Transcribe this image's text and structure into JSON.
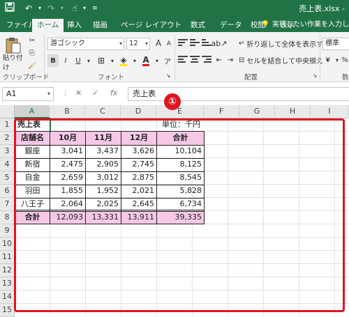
{
  "window": {
    "filename": "売上表.xlsx -"
  },
  "quick_access": {
    "save_icon": "save-icon",
    "undo_icon": "undo-icon",
    "redo_icon": "redo-icon",
    "touch_icon": "touch-mode-icon",
    "customize_icon": "customize-icon"
  },
  "tabs": [
    {
      "label": "ファイル",
      "active": false
    },
    {
      "label": "ホーム",
      "active": true
    },
    {
      "label": "挿入",
      "active": false
    },
    {
      "label": "描画",
      "active": false
    },
    {
      "label": "ページ レイアウト",
      "active": false
    },
    {
      "label": "数式",
      "active": false
    },
    {
      "label": "データ",
      "active": false
    },
    {
      "label": "校閲",
      "active": false
    },
    {
      "label": "表示",
      "active": false
    }
  ],
  "tell_me": "実行したい作業を入力し",
  "ribbon": {
    "clipboard": {
      "paste_label": "貼り付け",
      "group_label": "クリップボード"
    },
    "font": {
      "font_name": "游ゴシック",
      "font_size": "12",
      "bold": "B",
      "italic": "I",
      "underline": "U",
      "group_label": "フォント",
      "accent_color": "#e0141e"
    },
    "alignment": {
      "wrap_label": "折り返して全体を表示する",
      "merge_label": "セルを結合して中央揃え",
      "group_label": "配置"
    },
    "number": {
      "format": "標準",
      "group_label": "数"
    }
  },
  "formula_bar": {
    "name_box": "A1",
    "fx": "fx",
    "value": "売上表"
  },
  "columns": [
    "A",
    "B",
    "C",
    "D",
    "E",
    "F",
    "G",
    "H",
    "I"
  ],
  "rows": [
    "1",
    "2",
    "3",
    "4",
    "5",
    "6",
    "7",
    "8",
    "9",
    "10",
    "11",
    "12",
    "13",
    "14",
    "15"
  ],
  "sheet": {
    "title": "売上表",
    "unit": "単位：千円",
    "headers": [
      "店舗名",
      "10月",
      "11月",
      "12月",
      "合計"
    ],
    "data": [
      [
        "銀座",
        "3,041",
        "3,437",
        "3,626",
        "10,104"
      ],
      [
        "新宿",
        "2,475",
        "2,905",
        "2,745",
        "8,125"
      ],
      [
        "自金",
        "2,659",
        "3,012",
        "2,875",
        "8,545"
      ],
      [
        "羽田",
        "1,855",
        "1,952",
        "2,021",
        "5,828"
      ],
      [
        "八王子",
        "2,064",
        "2,025",
        "2,645",
        "6,734"
      ]
    ],
    "total": [
      "合計",
      "12,093",
      "13,331",
      "13,911",
      "39,335"
    ]
  },
  "annotation": {
    "badge": "①",
    "color": "#e0141e"
  }
}
